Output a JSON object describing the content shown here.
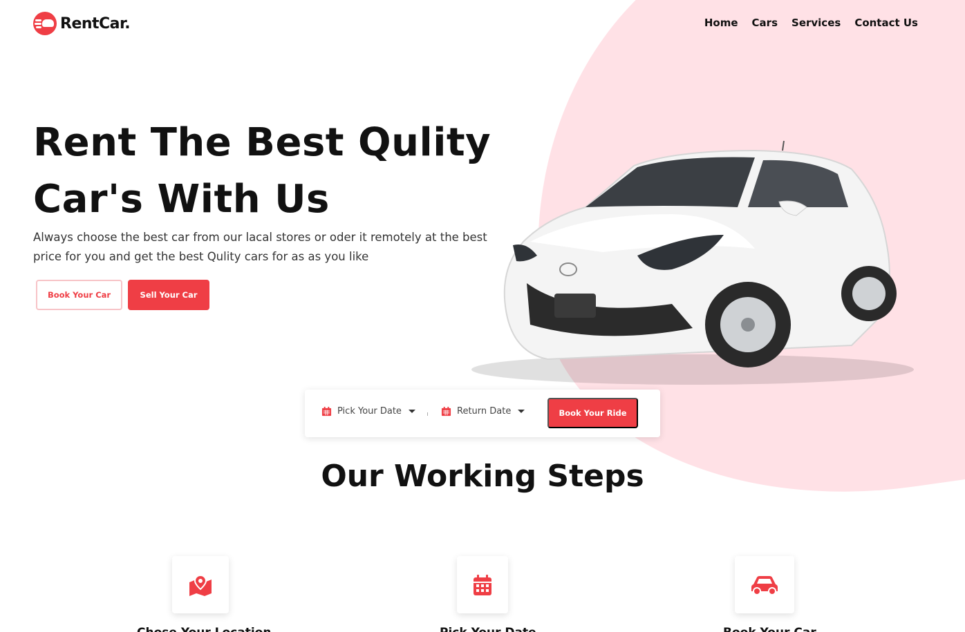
{
  "brand": {
    "name": "RentCar.",
    "accent": "#ef3e45",
    "blob": "#ffe1e6"
  },
  "nav": {
    "items": [
      "Home",
      "Cars",
      "Services",
      "Contact Us"
    ]
  },
  "hero": {
    "title_line1": "Rent The Best Qulity",
    "title_line2": "Car's With Us",
    "subtitle": "Always choose the best car from our lacal stores or oder it remotely at the best price for you and get the best Qulity cars for as as you like",
    "book_button": "Book Your Car",
    "sell_button": "Sell Your Car"
  },
  "booking": {
    "pick_date": "Pick Your Date",
    "return_date": "Return Date",
    "submit": "Book Your Ride"
  },
  "steps": {
    "title": "Our Working Steps",
    "items": [
      {
        "icon": "map-marker-icon",
        "label": "Chose Your Location"
      },
      {
        "icon": "calendar-icon",
        "label": "Pick Your Date"
      },
      {
        "icon": "car-icon",
        "label": "Book Your Car"
      }
    ]
  }
}
